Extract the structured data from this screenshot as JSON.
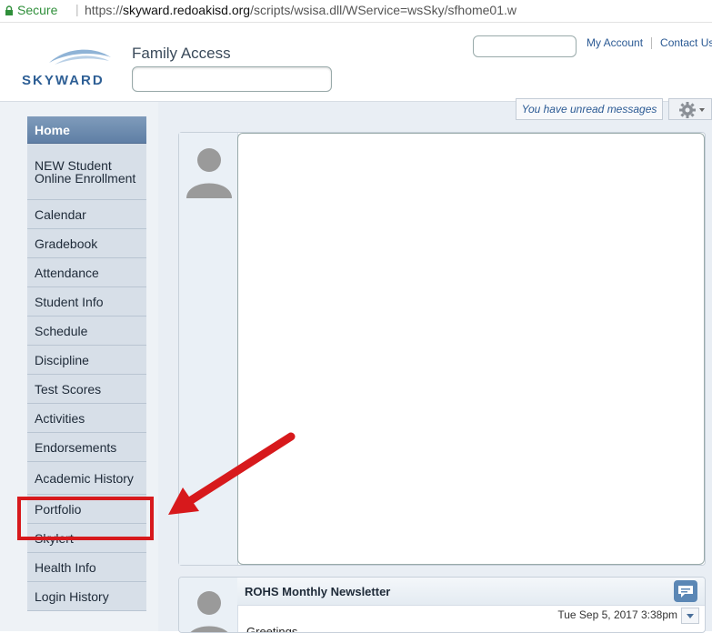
{
  "browser": {
    "secure_label": "Secure",
    "url_prefix": "https://",
    "url_domain": "skyward.redoakisd.org",
    "url_path": "/scripts/wsisa.dll/WService=wsSky/sfhome01.w"
  },
  "header": {
    "logo_text": "SKYWARD",
    "app_title": "Family Access",
    "search_value": "",
    "top_input_value": "",
    "my_account": "My Account",
    "contact_us": "Contact Us"
  },
  "messages": {
    "unread": "You have unread messages"
  },
  "nav": {
    "items": [
      {
        "label": "Home",
        "active": true
      },
      {
        "label": "NEW Student Online Enrollment"
      },
      {
        "label": "Calendar"
      },
      {
        "label": "Gradebook"
      },
      {
        "label": "Attendance"
      },
      {
        "label": "Student Info"
      },
      {
        "label": "Schedule"
      },
      {
        "label": "Discipline"
      },
      {
        "label": "Test Scores"
      },
      {
        "label": "Activities"
      },
      {
        "label": "Endorsements"
      },
      {
        "label": "Academic History"
      },
      {
        "label": "Portfolio"
      },
      {
        "label": "Skylert"
      },
      {
        "label": "Health Info"
      },
      {
        "label": "Login History"
      }
    ]
  },
  "posts": [
    {
      "title": "",
      "date": "",
      "body": ""
    },
    {
      "title": "ROHS Monthly Newsletter",
      "date": "Tue Sep 5, 2017 3:38pm",
      "body": "Greetings"
    }
  ],
  "colors": {
    "annotation_red": "#d7191c",
    "nav_active": "#6f8db0",
    "link_blue": "#2b5a94"
  }
}
